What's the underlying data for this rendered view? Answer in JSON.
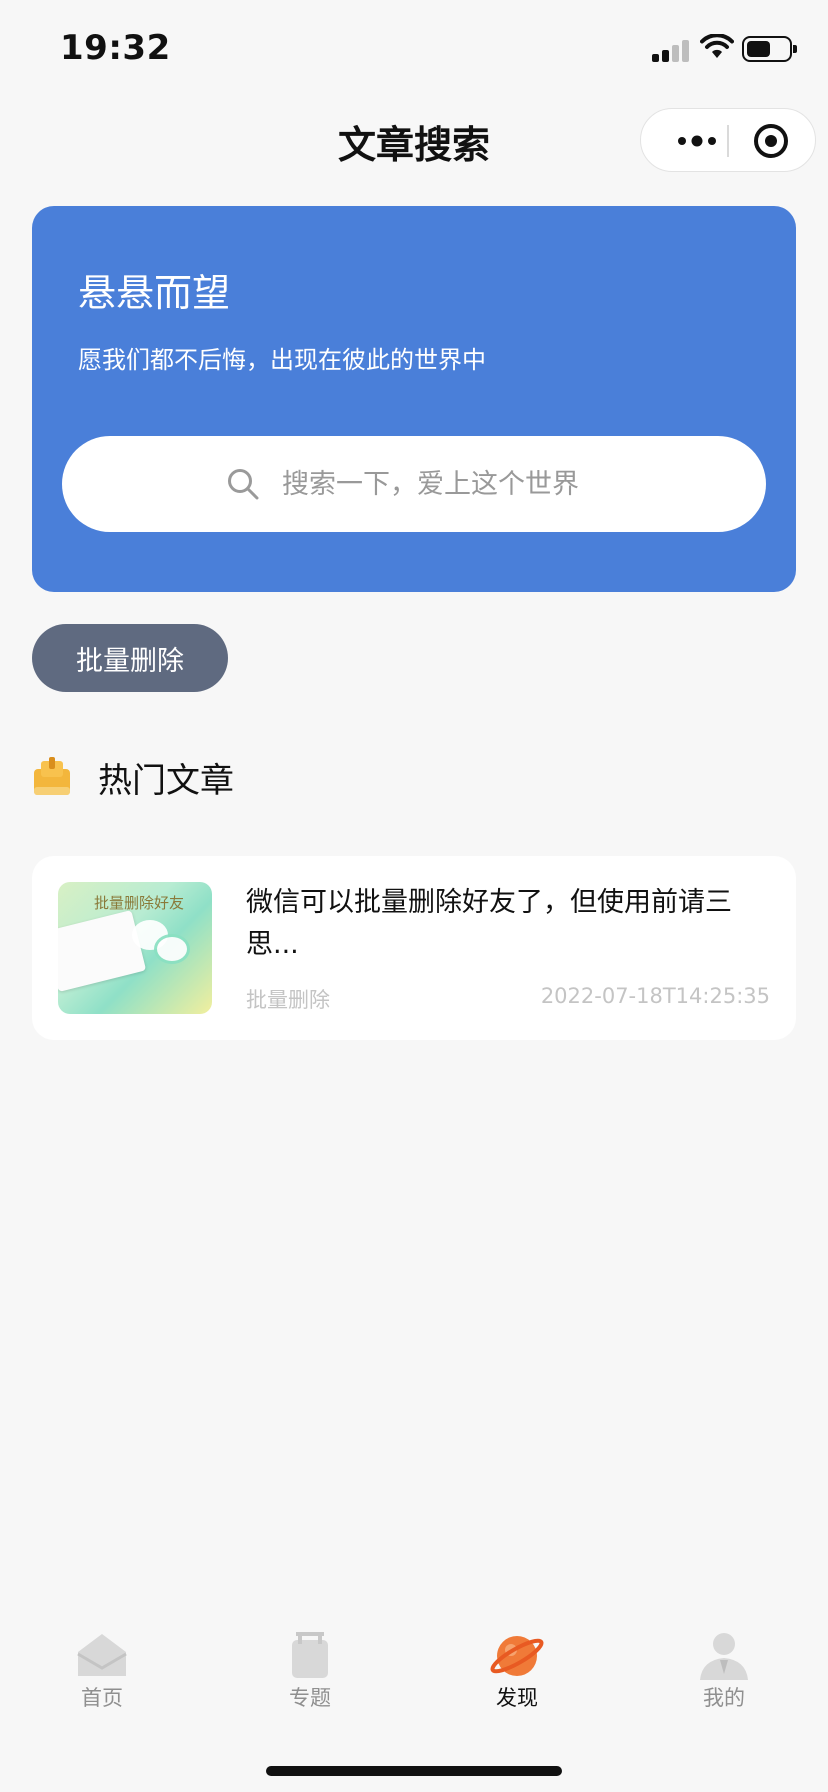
{
  "status_bar": {
    "time": "19:32",
    "signal_icon": "signal-icon",
    "wifi_icon": "wifi-icon",
    "battery_icon": "battery-icon",
    "battery_level": 0.6
  },
  "nav": {
    "title": "文章搜索",
    "more_icon": "more-icon",
    "close_icon": "target-icon"
  },
  "hero": {
    "title": "悬悬而望",
    "subtitle": "愿我们都不后悔，出现在彼此的世界中",
    "search_placeholder": "搜索一下，爱上这个世界",
    "background_color": "#4a7fd9"
  },
  "actions": {
    "batch_delete_label": "批量删除"
  },
  "section": {
    "hot_label": "热门文章"
  },
  "articles": [
    {
      "thumb_text": "批量删除好友",
      "title": "微信可以批量删除好友了，但使用前请三思...",
      "tag": "批量删除",
      "date": "2022-07-18T14:25:35"
    }
  ],
  "tabbar": {
    "items": [
      {
        "label": "首页",
        "icon": "home-icon",
        "active": false
      },
      {
        "label": "专题",
        "icon": "topic-icon",
        "active": false
      },
      {
        "label": "发现",
        "icon": "discover-icon",
        "active": true
      },
      {
        "label": "我的",
        "icon": "profile-icon",
        "active": false
      }
    ]
  },
  "colors": {
    "accent": "#4a7fd9",
    "button_gray": "#5f6a80",
    "discover_orange": "#f07a38"
  }
}
